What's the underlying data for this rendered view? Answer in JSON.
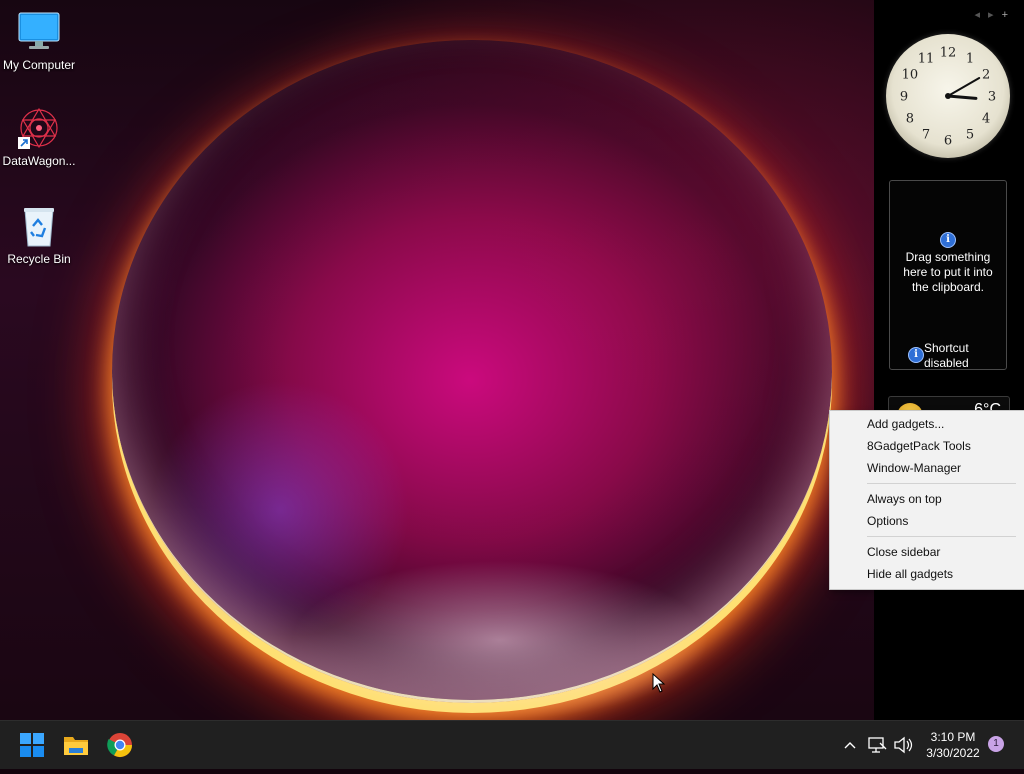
{
  "desktop": {
    "icons": [
      {
        "label": "My Computer",
        "icon": "monitor-icon"
      },
      {
        "label": "DataWagon...",
        "icon": "datawagon-app-icon"
      },
      {
        "label": "Recycle Bin",
        "icon": "recycle-bin-icon"
      }
    ]
  },
  "sidebar": {
    "nav": {
      "prev": "◂",
      "next": "▸",
      "add": "+"
    },
    "clock": {
      "numerals": [
        "12",
        "1",
        "2",
        "3",
        "4",
        "5",
        "6",
        "7",
        "8",
        "9",
        "10",
        "11"
      ],
      "hour": 3,
      "minute": 10
    },
    "clipboard": {
      "info_glyph": "i",
      "message": "Drag something here to put it into the clipboard.",
      "shortcut_line1": "Shortcut",
      "shortcut_line2": "disabled"
    },
    "weather": {
      "temp": "6°C"
    }
  },
  "context_menu": {
    "items": [
      "Add gadgets...",
      "8GadgetPack Tools",
      "Window-Manager",
      "Always on top",
      "Options",
      "Close sidebar",
      "Hide all gadgets"
    ]
  },
  "taskbar": {
    "apps": [
      {
        "name": "Start",
        "icon": "windows-start-icon"
      },
      {
        "name": "File Explorer",
        "icon": "folder-icon"
      },
      {
        "name": "Google Chrome",
        "icon": "chrome-icon"
      }
    ],
    "tray": {
      "chevron": "^"
    },
    "time": "3:10 PM",
    "date": "3/30/2022",
    "notification_count": "1"
  },
  "colors": {
    "accent": "#0078d4",
    "taskbar": "#202020",
    "menu_bg": "#f2f2f2"
  }
}
